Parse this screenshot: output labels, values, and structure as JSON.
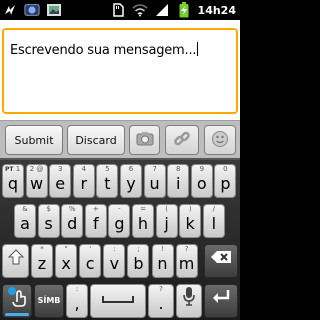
{
  "status_bar": {
    "time": "14h24",
    "left_icons": [
      "usb-debug-icon",
      "media-icon",
      "photo-icon"
    ],
    "right_icons": [
      "sd-card-icon",
      "wifi-icon",
      "signal-icon",
      "battery-charging-icon"
    ]
  },
  "compose": {
    "text": "Escrevendo sua mensagem..."
  },
  "actions": {
    "submit_label": "Submit",
    "discard_label": "Discard",
    "camera_icon": "camera-icon",
    "link_icon": "link-icon",
    "emoji_icon": "emoji-icon"
  },
  "keyboard": {
    "row1": [
      {
        "main": "q",
        "hint": "1",
        "hint2": "PT"
      },
      {
        "main": "w",
        "hint": "2 @"
      },
      {
        "main": "e",
        "hint": "3"
      },
      {
        "main": "r",
        "hint": "4"
      },
      {
        "main": "t",
        "hint": "5"
      },
      {
        "main": "y",
        "hint": "6"
      },
      {
        "main": "u",
        "hint": "7"
      },
      {
        "main": "i",
        "hint": "8"
      },
      {
        "main": "o",
        "hint": "9"
      },
      {
        "main": "p",
        "hint": "0"
      }
    ],
    "row2": [
      {
        "main": "a",
        "hint": "&"
      },
      {
        "main": "s",
        "hint": "$"
      },
      {
        "main": "d",
        "hint": "%"
      },
      {
        "main": "f",
        "hint": "+"
      },
      {
        "main": "g",
        "hint": "-"
      },
      {
        "main": "h",
        "hint": "="
      },
      {
        "main": "j",
        "hint": "("
      },
      {
        "main": "k",
        "hint": ")"
      },
      {
        "main": "l",
        "hint": "/"
      }
    ],
    "row3": [
      {
        "main": "z",
        "hint": "*"
      },
      {
        "main": "x",
        "hint": "\""
      },
      {
        "main": "c",
        "hint": "'"
      },
      {
        "main": "v",
        "hint": ":"
      },
      {
        "main": "b",
        "hint": ";"
      },
      {
        "main": "n",
        "hint": "!"
      },
      {
        "main": "m",
        "hint": "?"
      }
    ],
    "symbols_label": "SÍMB",
    "comma": ",",
    "comma_hint": ":",
    "period": ".",
    "period_hint": "?"
  }
}
